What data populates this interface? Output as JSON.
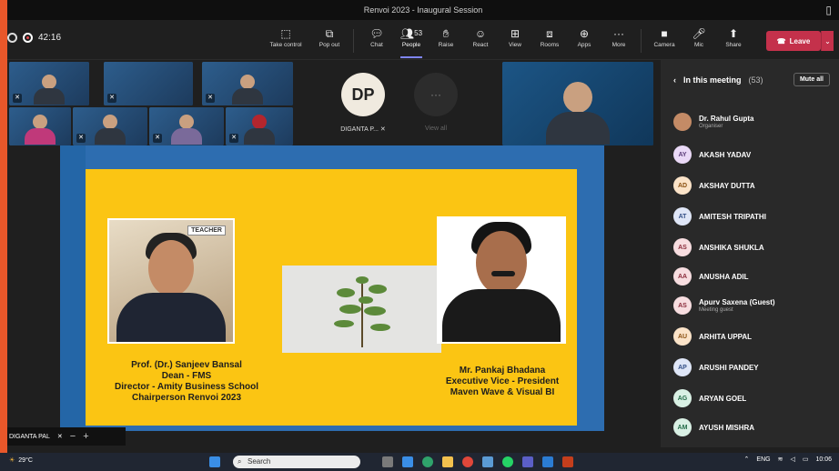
{
  "window": {
    "title": "Renvoi 2023 - Inaugural Session"
  },
  "toolbar": {
    "timer": "42:16",
    "take_control": "Take control",
    "pop_out": "Pop out",
    "chat": "Chat",
    "people": "People",
    "people_count": "53",
    "raise": "Raise",
    "react": "React",
    "view": "View",
    "rooms": "Rooms",
    "apps": "Apps",
    "more": "More",
    "camera": "Camera",
    "mic": "Mic",
    "share": "Share",
    "leave": "Leave"
  },
  "gallery": {
    "avatar_initials": "DP",
    "avatar_name": "DIGANTA P...",
    "view_all": "View all"
  },
  "slide": {
    "teacher_sign": "TEACHER",
    "left_caption": [
      "Prof. (Dr.) Sanjeev Bansal",
      "Dean - FMS",
      "Director - Amity Business School",
      "Chairperson Renvoi 2023"
    ],
    "right_caption": [
      "Mr. Pankaj Bhadana",
      "Executive Vice - President",
      "Maven Wave & Visual BI"
    ]
  },
  "self_view": {
    "name": "DIGANTA PAL",
    "minus": "−",
    "plus": "+"
  },
  "panel": {
    "title": "In this meeting",
    "count": "(53)",
    "mute_all": "Mute all",
    "members": [
      {
        "initials": "",
        "name": "Dr. Rahul Gupta",
        "sub": "Organiser"
      },
      {
        "initials": "AY",
        "name": "AKASH YADAV",
        "sub": ""
      },
      {
        "initials": "AD",
        "name": "AKSHAY DUTTA",
        "sub": ""
      },
      {
        "initials": "AT",
        "name": "AMITESH TRIPATHI",
        "sub": ""
      },
      {
        "initials": "AS",
        "name": "ANSHIKA SHUKLA",
        "sub": ""
      },
      {
        "initials": "AA",
        "name": "ANUSHA ADIL",
        "sub": ""
      },
      {
        "initials": "AS",
        "name": "Apurv Saxena (Guest)",
        "sub": "Meeting guest"
      },
      {
        "initials": "AU",
        "name": "ARHITA UPPAL",
        "sub": ""
      },
      {
        "initials": "AP",
        "name": "ARUSHI PANDEY",
        "sub": ""
      },
      {
        "initials": "AG",
        "name": "ARYAN GOEL",
        "sub": ""
      },
      {
        "initials": "AM",
        "name": "AYUSH MISHRA",
        "sub": ""
      }
    ]
  },
  "taskbar": {
    "temperature": "29°C",
    "search": "Search",
    "lang": "ENG",
    "time": "10:06"
  }
}
